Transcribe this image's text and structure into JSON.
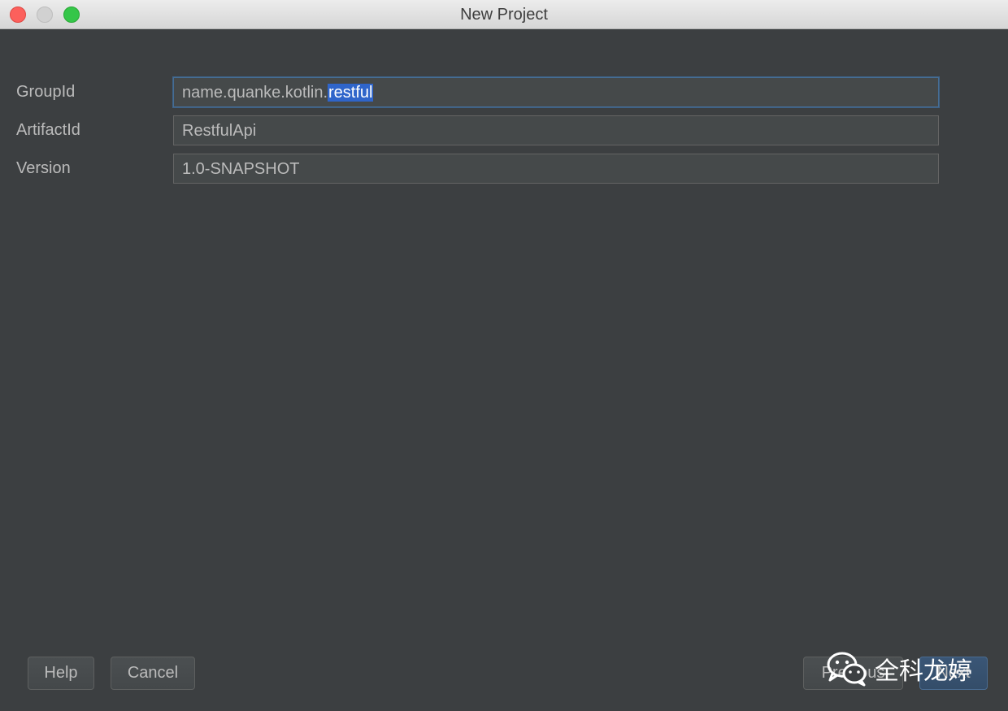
{
  "window": {
    "title": "New Project"
  },
  "form": {
    "groupid_label": "GroupId",
    "groupid_value_prefix": "name.quanke.kotlin.",
    "groupid_value_selected": "restful",
    "artifactid_label": "ArtifactId",
    "artifactid_value": "RestfulApi",
    "version_label": "Version",
    "version_value": "1.0-SNAPSHOT"
  },
  "buttons": {
    "help": "Help",
    "cancel": "Cancel",
    "previous": "Previous",
    "next": "Next"
  },
  "watermark": {
    "text": "全科龙婷",
    "icon": "wechat-icon"
  },
  "colors": {
    "background": "#3c3f41",
    "selection": "#2f65ca",
    "focus_border": "#466d94"
  }
}
